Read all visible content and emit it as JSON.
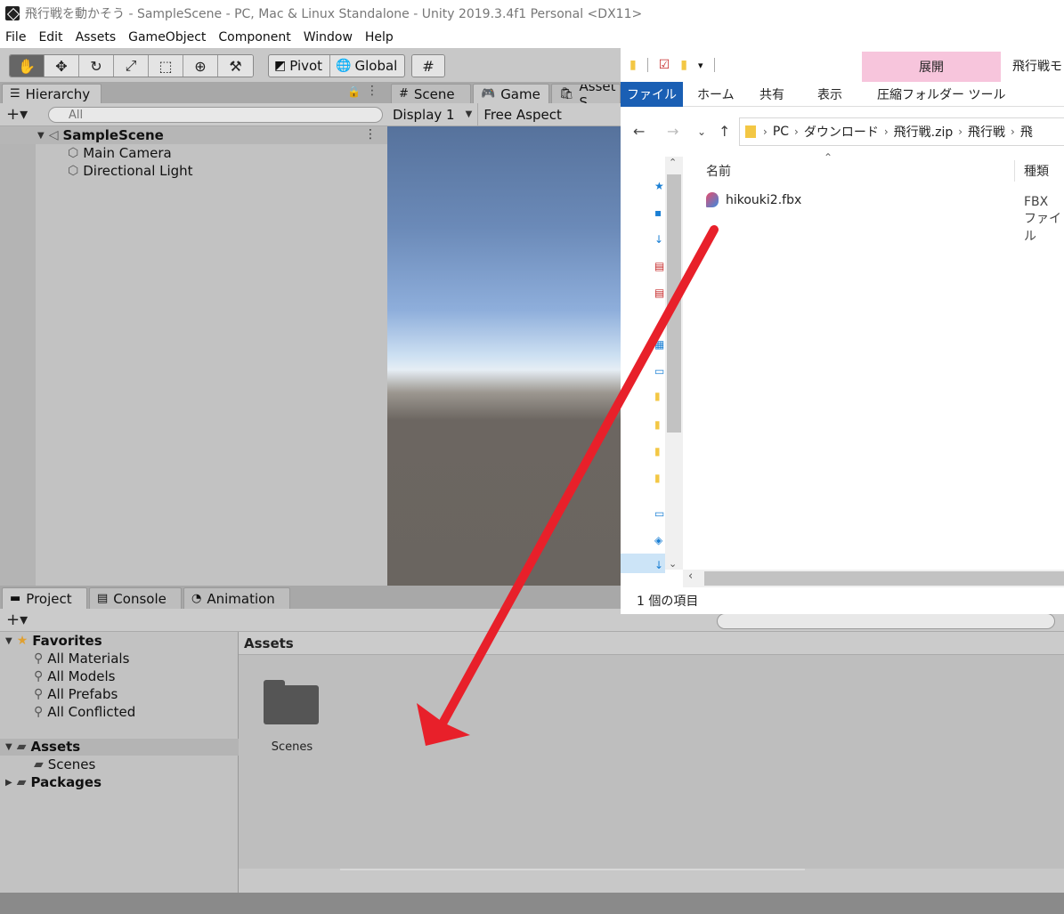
{
  "window": {
    "title": "飛行戦を動かそう - SampleScene - PC, Mac & Linux Standalone - Unity 2019.3.4f1 Personal <DX11>"
  },
  "menu": [
    "File",
    "Edit",
    "Assets",
    "GameObject",
    "Component",
    "Window",
    "Help"
  ],
  "toolbar": {
    "pivot_label": "Pivot",
    "global_label": "Global"
  },
  "hierarchy": {
    "tab_label": "Hierarchy",
    "search_placeholder": "All",
    "scene_name": "SampleScene",
    "items": [
      "Main Camera",
      "Directional Light"
    ]
  },
  "center_tabs": {
    "scene_label": "Scene",
    "game_label": "Game",
    "asset_store_label": "Asset S"
  },
  "game": {
    "display_label": "Display 1",
    "aspect_label": "Free Aspect"
  },
  "bottom_tabs": {
    "project_label": "Project",
    "console_label": "Console",
    "animation_label": "Animation"
  },
  "project": {
    "favorites_label": "Favorites",
    "favorites": [
      "All Materials",
      "All Models",
      "All Prefabs",
      "All Conflicted"
    ],
    "assets_label": "Assets",
    "assets_children": [
      "Scenes"
    ],
    "packages_label": "Packages",
    "content_header": "Assets",
    "content_items": [
      "Scenes"
    ]
  },
  "explorer": {
    "context_tab_label": "展開",
    "window_title": "飛行戦モ",
    "file_tab": "ファイル",
    "ribbon_tabs": [
      "ホーム",
      "共有",
      "表示"
    ],
    "context_ribbon_tab": "圧縮フォルダー ツール",
    "breadcrumbs": [
      "PC",
      "ダウンロード",
      "飛行戦.zip",
      "飛行戦",
      "飛"
    ],
    "columns": {
      "name": "名前",
      "type": "種類"
    },
    "files": [
      {
        "name": "hikouki2.fbx",
        "type": "FBX ファイル"
      }
    ],
    "status": "1 個の項目"
  },
  "colors": {
    "annotation_arrow": "#e8202a",
    "file_tab_blue": "#1a5fb4",
    "context_tab_pink": "#f7c5dc"
  }
}
